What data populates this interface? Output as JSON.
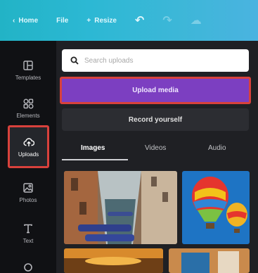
{
  "topbar": {
    "home": "Home",
    "file": "File",
    "resize": "Resize"
  },
  "sidebar": {
    "items": [
      {
        "label": "Templates",
        "icon": "templates-icon"
      },
      {
        "label": "Elements",
        "icon": "elements-icon"
      },
      {
        "label": "Uploads",
        "icon": "uploads-icon",
        "active": true
      },
      {
        "label": "Photos",
        "icon": "photos-icon"
      },
      {
        "label": "Text",
        "icon": "text-icon"
      }
    ]
  },
  "search": {
    "placeholder": "Search uploads"
  },
  "buttons": {
    "upload": "Upload media",
    "record": "Record yourself"
  },
  "tabs": [
    {
      "label": "Images",
      "active": true
    },
    {
      "label": "Videos"
    },
    {
      "label": "Audio"
    }
  ],
  "colors": {
    "accent": "#7c3fc1",
    "highlight": "#d8413c",
    "topbar": "#2cb8d4"
  }
}
